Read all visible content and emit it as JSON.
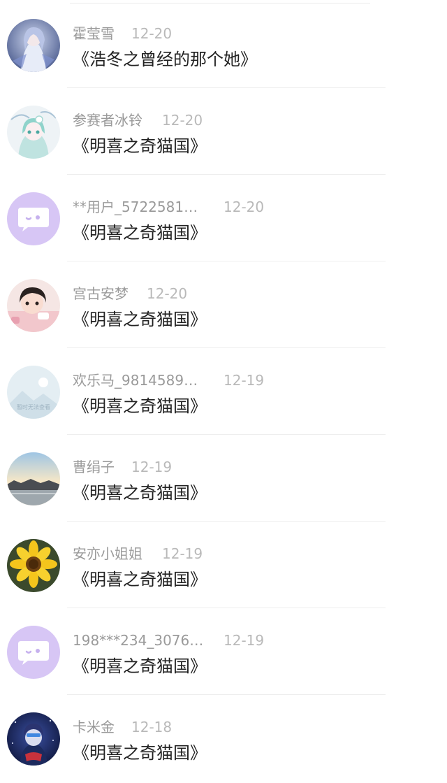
{
  "comments": [
    {
      "name": "霍莹雪",
      "date": "12-20",
      "title": "《浩冬之曾经的那个她》",
      "avatar": "anime-girl-blue"
    },
    {
      "name": "参赛者冰铃",
      "date": "12-20",
      "title": "《明喜之奇猫国》",
      "avatar": "anime-girl-teal"
    },
    {
      "name": "**用户_5722581…",
      "date": "12-20",
      "title": "《明喜之奇猫国》",
      "avatar": "default-chat-bubble"
    },
    {
      "name": "宫古安梦",
      "date": "12-20",
      "title": "《明喜之奇猫国》",
      "avatar": "child-photo"
    },
    {
      "name": "欢乐马_9814589…",
      "date": "12-19",
      "title": "《明喜之奇猫国》",
      "avatar": "image-unavailable",
      "avatar_text": "暂时无法查看"
    },
    {
      "name": "曹绢子",
      "date": "12-19",
      "title": "《明喜之奇猫国》",
      "avatar": "sunset-landscape"
    },
    {
      "name": "安亦小姐姐",
      "date": "12-19",
      "title": "《明喜之奇猫国》",
      "avatar": "sunflower"
    },
    {
      "name": "198***234_3076…",
      "date": "12-19",
      "title": "《明喜之奇猫国》",
      "avatar": "default-chat-bubble"
    },
    {
      "name": "卡米金",
      "date": "12-18",
      "title": "《明喜之奇猫国》",
      "avatar": "anime-dark-night"
    }
  ]
}
